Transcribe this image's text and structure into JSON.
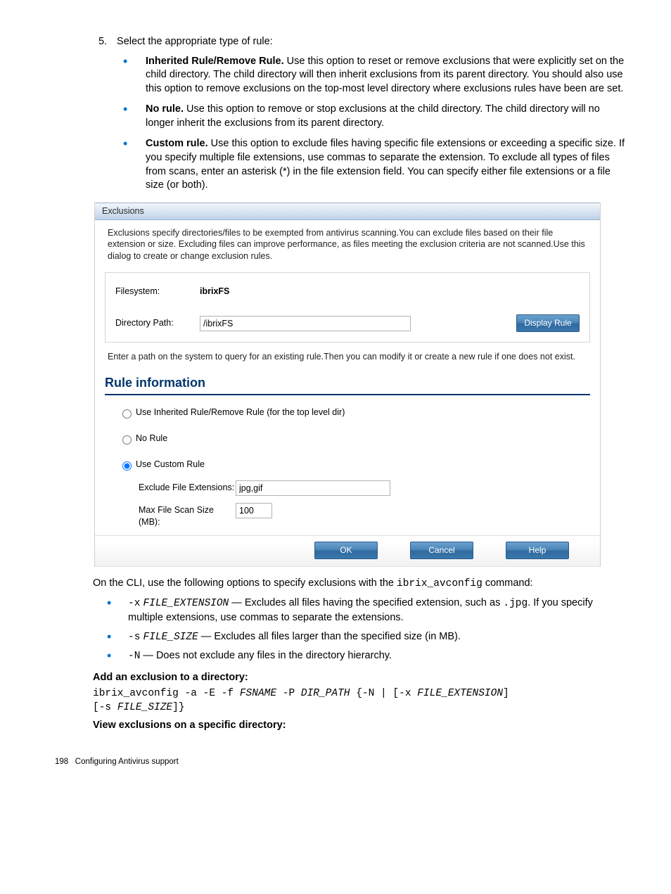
{
  "step": {
    "number": "5.",
    "text": "Select the appropriate type of rule:"
  },
  "bullets": [
    {
      "title": "Inherited Rule/Remove Rule.",
      "body": " Use this option to reset or remove exclusions that were explicitly set on the child directory. The child directory will then inherit exclusions from its parent directory. You should also use this option to remove exclusions on the top-most level directory where exclusions rules have been are set."
    },
    {
      "title": "No rule.",
      "body": " Use this option to remove or stop exclusions at the child directory. The child directory will no longer inherit the exclusions from its parent directory."
    },
    {
      "title": "Custom rule.",
      "body": " Use this option to exclude files having specific file extensions or exceeding a specific size. If you specify multiple file extensions, use commas to separate the extension. To exclude all types of files from scans, enter an asterisk (*) in the file extension field. You can specify either file extensions or a file size (or both)."
    }
  ],
  "dialog": {
    "header": "Exclusions",
    "description": "Exclusions specify directories/files to be exempted from antivirus scanning.You can exclude files based on their file extension or size. Excluding files can improve performance, as files meeting the exclusion criteria are not scanned.Use this dialog to create or change exclusion rules.",
    "filesystem_label": "Filesystem:",
    "filesystem_value": "ibrixFS",
    "path_label": "Directory Path:",
    "path_value": "/ibrixFS",
    "display_btn": "Display Rule",
    "hint": "Enter a path on the system to query for an existing rule.Then you can modify it or create a new rule if one does not exist.",
    "rule_header": "Rule information",
    "opt_inherited": "Use Inherited Rule/Remove Rule (for the top level dir)",
    "opt_norule": "No Rule",
    "opt_custom": "Use Custom Rule",
    "ext_label": "Exclude File Extensions:",
    "ext_value": "jpg,gif",
    "size_label": "Max File Scan Size (MB):",
    "size_value": "100",
    "ok": "OK",
    "cancel": "Cancel",
    "help": "Help"
  },
  "cli_intro_pre": "On the CLI, use the following options to specify exclusions with the ",
  "cli_intro_cmd": "ibrix_avconfig",
  "cli_intro_post": " command:",
  "cli_opts": [
    {
      "flag": "-x",
      "arg": "FILE_EXTENSION",
      "body_pre": " — Excludes all files having the specified extension, such as ",
      "body_mono": ".jpg",
      "body_post": ". If you specify multiple extensions, use commas to separate the extensions."
    },
    {
      "flag": "-s",
      "arg": "FILE_SIZE",
      "body_pre": " — Excludes all files larger than the specified size (in MB).",
      "body_mono": "",
      "body_post": ""
    },
    {
      "flag": "-N",
      "arg": "",
      "body_pre": " — Does not exclude any files in the directory hierarchy.",
      "body_mono": "",
      "body_post": ""
    }
  ],
  "add_head": "Add an exclusion to a directory:",
  "add_cmd_parts": {
    "p1": "ibrix_avconfig -a -E -f ",
    "fsname": "FSNAME",
    "p2": " -P ",
    "dirpath": "DIR_PATH",
    "p3": " {-N | [-x ",
    "fileext": "FILE_EXTENSION",
    "p4": "]",
    "p5": "[-s ",
    "filesize": "FILE_SIZE",
    "p6": "]}"
  },
  "view_head": "View exclusions on a specific directory:",
  "footer": {
    "page": "198",
    "title": "Configuring Antivirus support"
  }
}
